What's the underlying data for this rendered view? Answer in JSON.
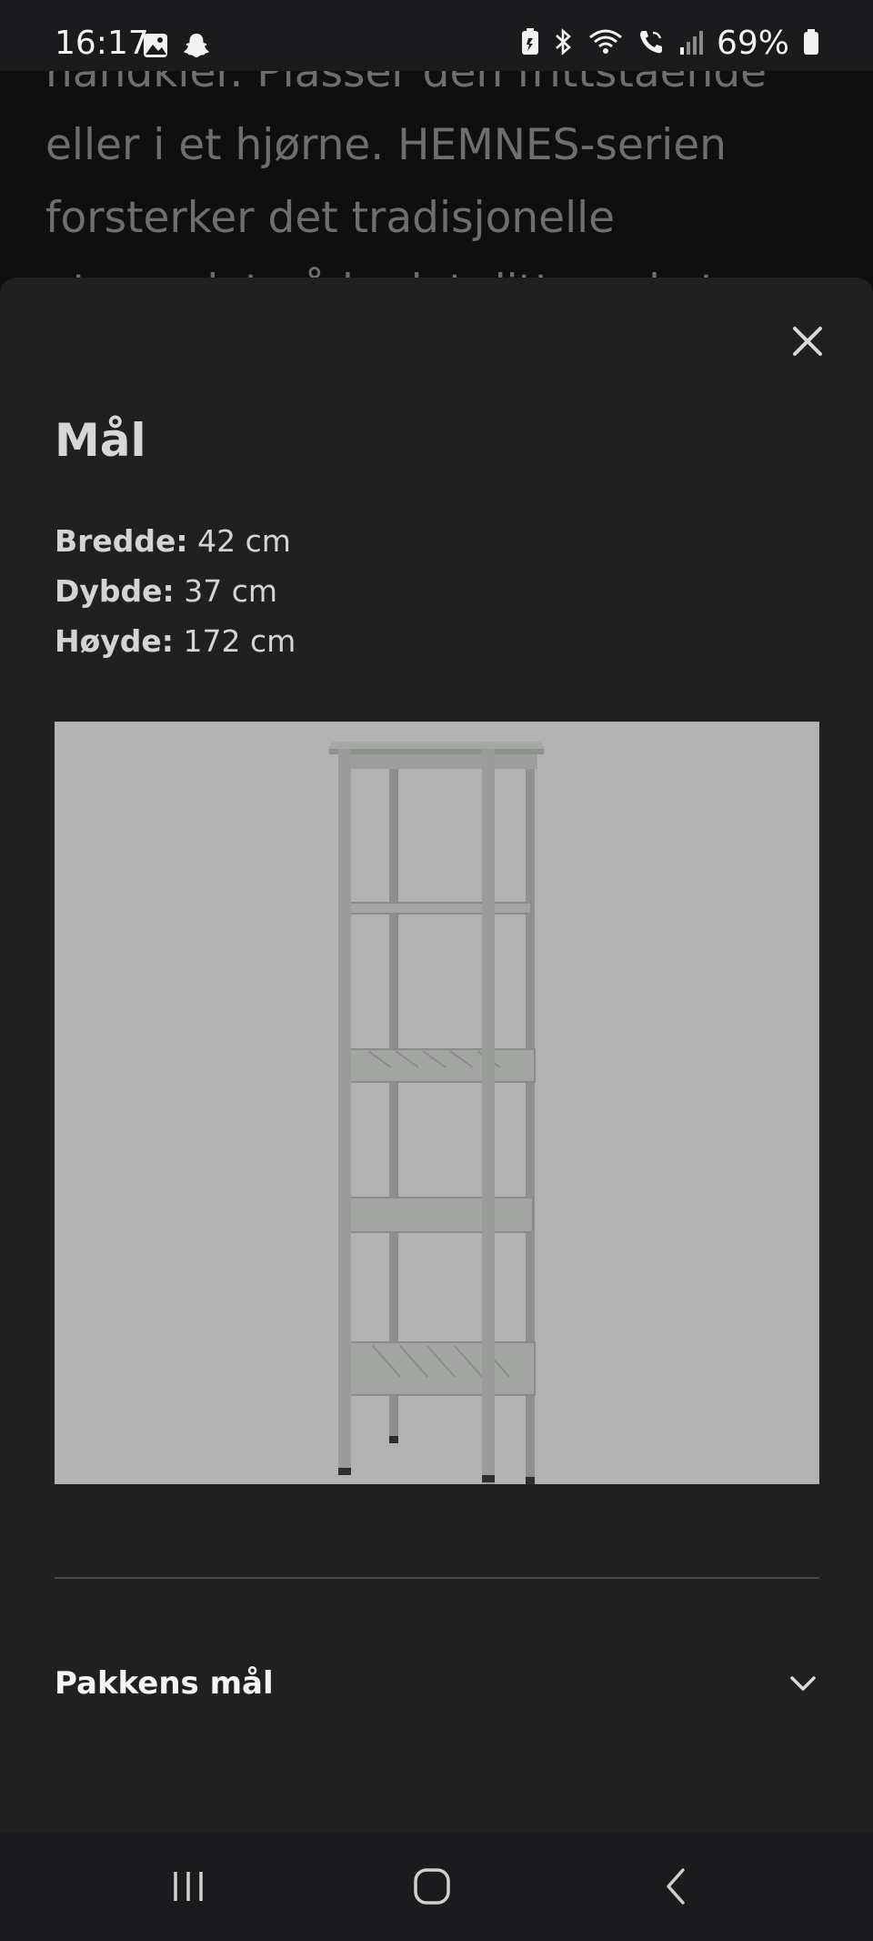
{
  "status_bar": {
    "time": "16:17",
    "battery_percent": "69%",
    "icons_left": [
      "gallery-icon",
      "snapchat-icon"
    ],
    "icons_right": [
      "battery-saver-icon",
      "bluetooth-icon",
      "wifi-icon",
      "wifi-call-icon",
      "signal-icon",
      "battery-icon"
    ]
  },
  "background_page": {
    "lines": [
      "håndkler. Plasser den frittstående",
      "eller i et hjørne. HEMNES-serien",
      "forsterker det tradisjonelle",
      "utseendet på badet ditt med et"
    ]
  },
  "sheet": {
    "title": "Mål",
    "dimensions": [
      {
        "label": "Bredde:",
        "value": "42 cm"
      },
      {
        "label": "Dybde:",
        "value": "37 cm"
      },
      {
        "label": "Høyde:",
        "value": "172 cm"
      }
    ],
    "image_icon": "shelf-unit-image",
    "accordion_label": "Pakkens mål"
  },
  "colors": {
    "sheet_bg": "#202021",
    "image_bg": "#b2b2b2",
    "status_bar_bg": "#1b1b1d"
  }
}
